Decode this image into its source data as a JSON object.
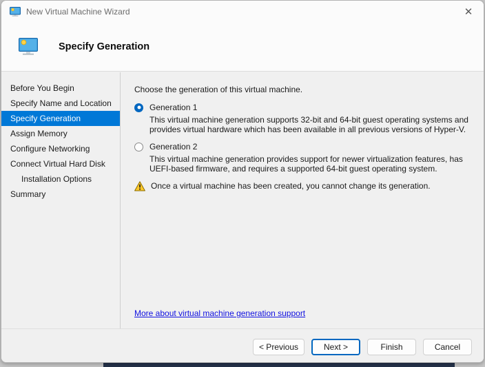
{
  "window": {
    "title": "New Virtual Machine Wizard",
    "close_glyph": "✕"
  },
  "header": {
    "title": "Specify Generation"
  },
  "sidebar": {
    "items": [
      {
        "label": "Before You Begin",
        "active": false,
        "indent": false
      },
      {
        "label": "Specify Name and Location",
        "active": false,
        "indent": false
      },
      {
        "label": "Specify Generation",
        "active": true,
        "indent": false
      },
      {
        "label": "Assign Memory",
        "active": false,
        "indent": false
      },
      {
        "label": "Configure Networking",
        "active": false,
        "indent": false
      },
      {
        "label": "Connect Virtual Hard Disk",
        "active": false,
        "indent": false
      },
      {
        "label": "Installation Options",
        "active": false,
        "indent": true
      },
      {
        "label": "Summary",
        "active": false,
        "indent": false
      }
    ]
  },
  "content": {
    "instruction": "Choose the generation of this virtual machine.",
    "options": [
      {
        "label": "Generation 1",
        "selected": true,
        "description": "This virtual machine generation supports 32-bit and 64-bit guest operating systems and provides virtual hardware which has been available in all previous versions of Hyper-V."
      },
      {
        "label": "Generation 2",
        "selected": false,
        "description": "This virtual machine generation provides support for newer virtualization features, has UEFI-based firmware, and requires a supported 64-bit guest operating system."
      }
    ],
    "warning": "Once a virtual machine has been created, you cannot change its generation.",
    "link": "More about virtual machine generation support"
  },
  "footer": {
    "buttons": [
      {
        "label": "< Previous",
        "focused": false
      },
      {
        "label": "Next >",
        "focused": true
      },
      {
        "label": "Finish",
        "focused": false
      },
      {
        "label": "Cancel",
        "focused": false
      }
    ]
  },
  "colors": {
    "nav_highlight": "#0078d7",
    "radio_accent": "#0067c0",
    "link": "#1010e0",
    "warning_yellow": "#fdc82a",
    "footer_bg": "#f0f0f0"
  }
}
